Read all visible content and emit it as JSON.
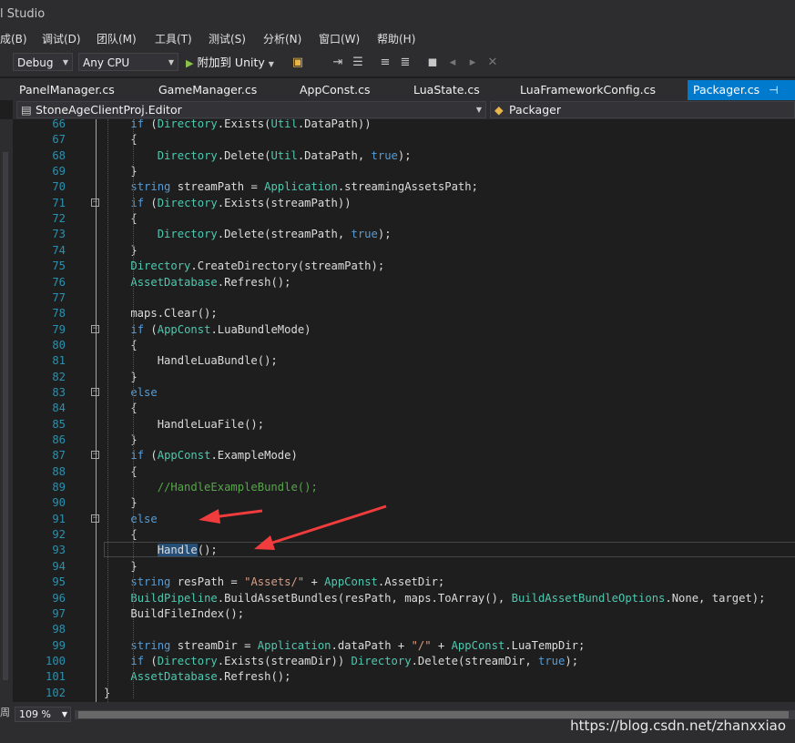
{
  "window": {
    "title": "l Studio"
  },
  "menu": [
    "成(B)",
    "调试(D)",
    "团队(M)",
    "工具(T)",
    "测试(S)",
    "分析(N)",
    "窗口(W)",
    "帮助(H)"
  ],
  "toolbar": {
    "config": "Debug",
    "platform": "Any CPU",
    "attach_label": "附加到 Unity"
  },
  "tabs": [
    "PanelManager.cs",
    "GameManager.cs",
    "AppConst.cs",
    "LuaState.cs",
    "LuaFrameworkConfig.cs",
    "Packager.cs"
  ],
  "navbar": {
    "project": "StoneAgeClientProj.Editor",
    "class": "Packager"
  },
  "code_lines": [
    {
      "n": "66",
      "t": "            if (Directory.Exists(Util.DataPath))"
    },
    {
      "n": "67",
      "t": "            {"
    },
    {
      "n": "68",
      "t": "                Directory.Delete(Util.DataPath, true);"
    },
    {
      "n": "69",
      "t": "            }"
    },
    {
      "n": "70",
      "t": "            string streamPath = Application.streamingAssetsPath;"
    },
    {
      "n": "71",
      "t": "            if (Directory.Exists(streamPath))"
    },
    {
      "n": "72",
      "t": "            {"
    },
    {
      "n": "73",
      "t": "                Directory.Delete(streamPath, true);"
    },
    {
      "n": "74",
      "t": "            }"
    },
    {
      "n": "75",
      "t": "            Directory.CreateDirectory(streamPath);"
    },
    {
      "n": "76",
      "t": "            AssetDatabase.Refresh();"
    },
    {
      "n": "77",
      "t": ""
    },
    {
      "n": "78",
      "t": "            maps.Clear();"
    },
    {
      "n": "79",
      "t": "            if (AppConst.LuaBundleMode)"
    },
    {
      "n": "80",
      "t": "            {"
    },
    {
      "n": "81",
      "t": "                HandleLuaBundle();"
    },
    {
      "n": "82",
      "t": "            }"
    },
    {
      "n": "83",
      "t": "            else"
    },
    {
      "n": "84",
      "t": "            {"
    },
    {
      "n": "85",
      "t": "                HandleLuaFile();"
    },
    {
      "n": "86",
      "t": "            }"
    },
    {
      "n": "87",
      "t": "            if (AppConst.ExampleMode)"
    },
    {
      "n": "88",
      "t": "            {"
    },
    {
      "n": "89",
      "t": "                //HandleExampleBundle();"
    },
    {
      "n": "90",
      "t": "            }"
    },
    {
      "n": "91",
      "t": "            else"
    },
    {
      "n": "92",
      "t": "            {"
    },
    {
      "n": "93",
      "t": "                Handle();"
    },
    {
      "n": "94",
      "t": "            }"
    },
    {
      "n": "95",
      "t": "            string resPath = \"Assets/\" + AppConst.AssetDir;"
    },
    {
      "n": "96",
      "t": "            BuildPipeline.BuildAssetBundles(resPath, maps.ToArray(), BuildAssetBundleOptions.None, target);"
    },
    {
      "n": "97",
      "t": "            BuildFileIndex();"
    },
    {
      "n": "98",
      "t": ""
    },
    {
      "n": "99",
      "t": "            string streamDir = Application.dataPath + \"/\" + AppConst.LuaTempDir;"
    },
    {
      "n": "100",
      "t": "            if (Directory.Exists(streamDir)) Directory.Delete(streamDir, true);"
    },
    {
      "n": "101",
      "t": "            AssetDatabase.Refresh();"
    },
    {
      "n": "102",
      "t": "        }"
    }
  ],
  "status": {
    "zoom": "109 %",
    "left_char": "周",
    "watermark": "https://blog.csdn.net/zhanxxiao"
  },
  "colors": {
    "accent": "#007acc",
    "keyword": "#569cd6",
    "type": "#4ec9b0",
    "string": "#d69d85",
    "comment": "#57a64a",
    "linenum": "#2b91af",
    "arrow": "#f03c3c"
  }
}
